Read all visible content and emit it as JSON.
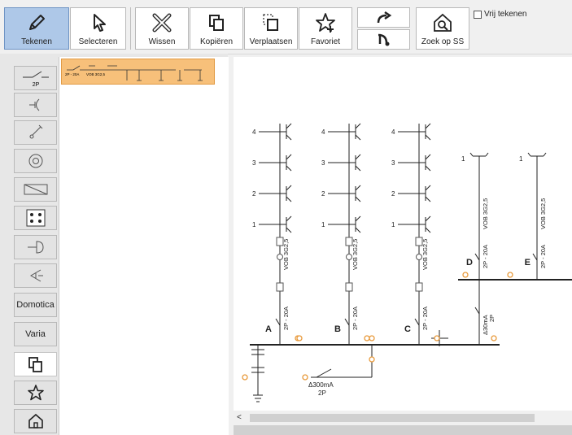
{
  "toolbar": {
    "draw": "Tekenen",
    "select": "Selecteren",
    "clear": "Wissen",
    "copy": "Kopiëren",
    "move": "Verplaatsen",
    "favorite": "Favoriet",
    "search_ss": "Zoek op SS",
    "free_draw": "Vrij tekenen"
  },
  "sidebar": {
    "switch_label": "2P",
    "domotica": "Domotica",
    "varia": "Varia"
  },
  "thumbnail": {
    "breaker": "2P - 20A",
    "cable": "VOB 3G2,5"
  },
  "schematic": {
    "circuits": [
      {
        "id": "A",
        "breaker": "2P - 20A",
        "cable": "VOB 3G2,5",
        "levels": [
          "4",
          "3",
          "2",
          "1"
        ]
      },
      {
        "id": "B",
        "breaker": "2P - 20A",
        "cable": "VOB 3G2,5",
        "levels": [
          "4",
          "3",
          "2",
          "1"
        ]
      },
      {
        "id": "C",
        "breaker": "2P - 20A",
        "cable": "VOB 3G2,5",
        "levels": [
          "4",
          "3",
          "2",
          "1"
        ]
      },
      {
        "id": "D",
        "breaker": "2P - 20A",
        "cable": "VOB 3G2,5",
        "levels": [
          "1"
        ]
      },
      {
        "id": "E",
        "breaker": "2P - 20A",
        "cable": "VOB 3G2,5",
        "levels": [
          "1"
        ]
      }
    ],
    "differential_main": "Δ300mA",
    "differential_main_poles": "2P",
    "differential_sub": "Δ30mA",
    "differential_sub_poles": "2P"
  }
}
